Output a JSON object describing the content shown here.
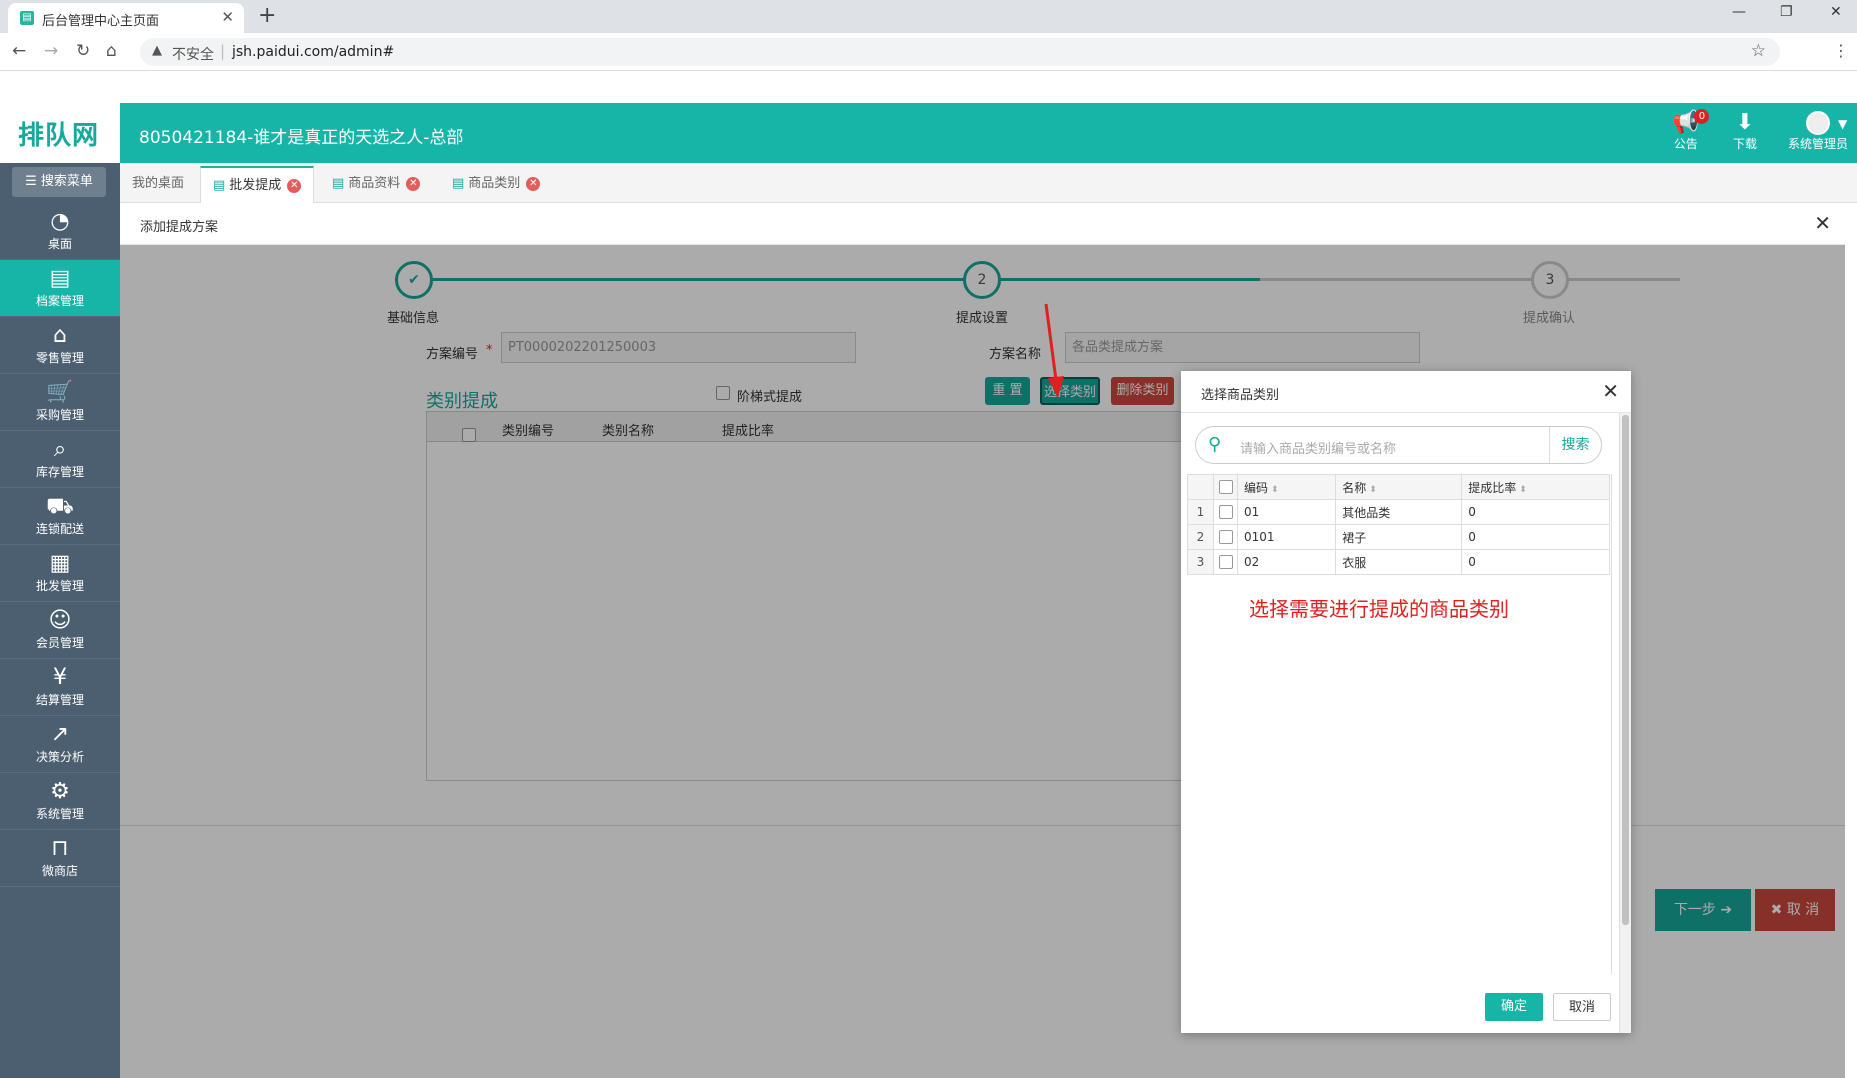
{
  "browser": {
    "tab_title": "后台管理中心主页面",
    "tab_close": "✕",
    "new_tab": "+",
    "security_label": "不安全",
    "url": "jsh.paidui.com/admin#",
    "win_minimize": "—",
    "win_restore": "❐",
    "win_close": "✕"
  },
  "header": {
    "logo_text": "排队网",
    "title": "8050421184-谁才是真正的天选之人-总部",
    "notice_label": "公告",
    "notice_count": "0",
    "download_label": "下载",
    "user_label": "系统管理员"
  },
  "sidebar": {
    "search_menu": "搜索菜单",
    "items": [
      {
        "label": "桌面",
        "icon": "dashboard-icon"
      },
      {
        "label": "档案管理",
        "icon": "archive-icon"
      },
      {
        "label": "零售管理",
        "icon": "store-icon"
      },
      {
        "label": "采购管理",
        "icon": "cart-icon"
      },
      {
        "label": "库存管理",
        "icon": "inventory-icon"
      },
      {
        "label": "连锁配送",
        "icon": "truck-icon"
      },
      {
        "label": "批发管理",
        "icon": "wholesale-icon"
      },
      {
        "label": "会员管理",
        "icon": "member-icon"
      },
      {
        "label": "结算管理",
        "icon": "settlement-icon"
      },
      {
        "label": "决策分析",
        "icon": "analysis-icon"
      },
      {
        "label": "系统管理",
        "icon": "gear-icon"
      },
      {
        "label": "微商店",
        "icon": "shop-icon"
      }
    ]
  },
  "tabs": [
    {
      "label": "我的桌面"
    },
    {
      "label": "批发提成"
    },
    {
      "label": "商品资料"
    },
    {
      "label": "商品类别"
    }
  ],
  "dialog": {
    "title": "添加提成方案",
    "close": "✕",
    "steps": [
      {
        "num": "✔",
        "label": "基础信息"
      },
      {
        "num": "2",
        "label": "提成设置"
      },
      {
        "num": "3",
        "label": "提成确认"
      }
    ],
    "code_label": "方案编号",
    "required_mark": "*",
    "code_value": "PT0000202201250003",
    "name_label": "方案名称",
    "name_value": "各品类提成方案",
    "section_title": "类别提成",
    "ladder_label": "阶梯式提成",
    "btn_reset": "重 置",
    "btn_select": "选择类别",
    "btn_delete": "删除类别",
    "grid_cols": [
      "类别编号",
      "类别名称",
      "提成比率"
    ],
    "btn_next": "下一步 ➔",
    "btn_cancel": "✖ 取 消"
  },
  "modal": {
    "title": "选择商品类别",
    "close": "✕",
    "search_placeholder": "请输入商品类别编号或名称",
    "search_button": "搜索",
    "columns": [
      "编码",
      "名称",
      "提成比率"
    ],
    "rows": [
      {
        "no": "1",
        "code": "01",
        "name": "其他品类",
        "rate": "0"
      },
      {
        "no": "2",
        "code": "0101",
        "name": "裙子",
        "rate": "0"
      },
      {
        "no": "3",
        "code": "02",
        "name": "衣服",
        "rate": "0"
      }
    ],
    "annotation": "选择需要进行提成的商品类别",
    "ok": "确定",
    "cancel": "取消"
  },
  "colors": {
    "brand": "#17b5a8",
    "sidebar": "#4c5f70",
    "danger": "#c9483e",
    "annotation": "#e02020"
  }
}
